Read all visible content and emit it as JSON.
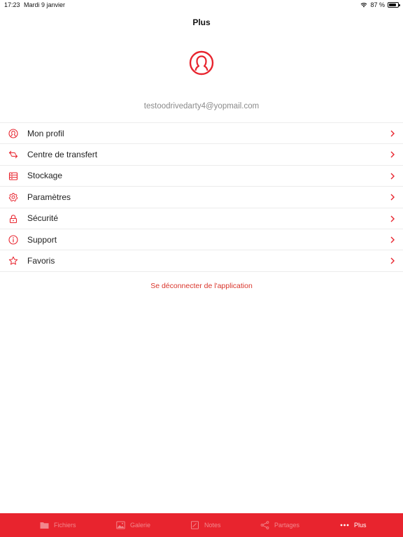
{
  "status": {
    "time": "17:23",
    "date": "Mardi 9 janvier",
    "battery": "87 %",
    "battery_level": 0.87
  },
  "header": {
    "title": "Plus"
  },
  "account": {
    "email": "testoodrivedarty4@yopmail.com"
  },
  "menu": [
    {
      "label": "Mon profil",
      "icon": "user-circle-icon"
    },
    {
      "label": "Centre de transfert",
      "icon": "transfer-arrows-icon"
    },
    {
      "label": "Stockage",
      "icon": "storage-icon"
    },
    {
      "label": "Paramètres",
      "icon": "gear-icon"
    },
    {
      "label": "Sécurité",
      "icon": "lock-icon"
    },
    {
      "label": "Support",
      "icon": "info-icon"
    },
    {
      "label": "Favoris",
      "icon": "star-icon"
    }
  ],
  "logout_label": "Se déconnecter de l'application",
  "tabs": [
    {
      "label": "Fichiers",
      "icon": "folder-icon",
      "active": false
    },
    {
      "label": "Galerie",
      "icon": "image-icon",
      "active": false
    },
    {
      "label": "Notes",
      "icon": "note-icon",
      "active": false
    },
    {
      "label": "Partages",
      "icon": "share-icon",
      "active": false
    },
    {
      "label": "Plus",
      "icon": "more-dots-icon",
      "active": true
    }
  ],
  "colors": {
    "accent": "#e8242e",
    "text": "#222222",
    "muted": "#8a8a8a"
  }
}
